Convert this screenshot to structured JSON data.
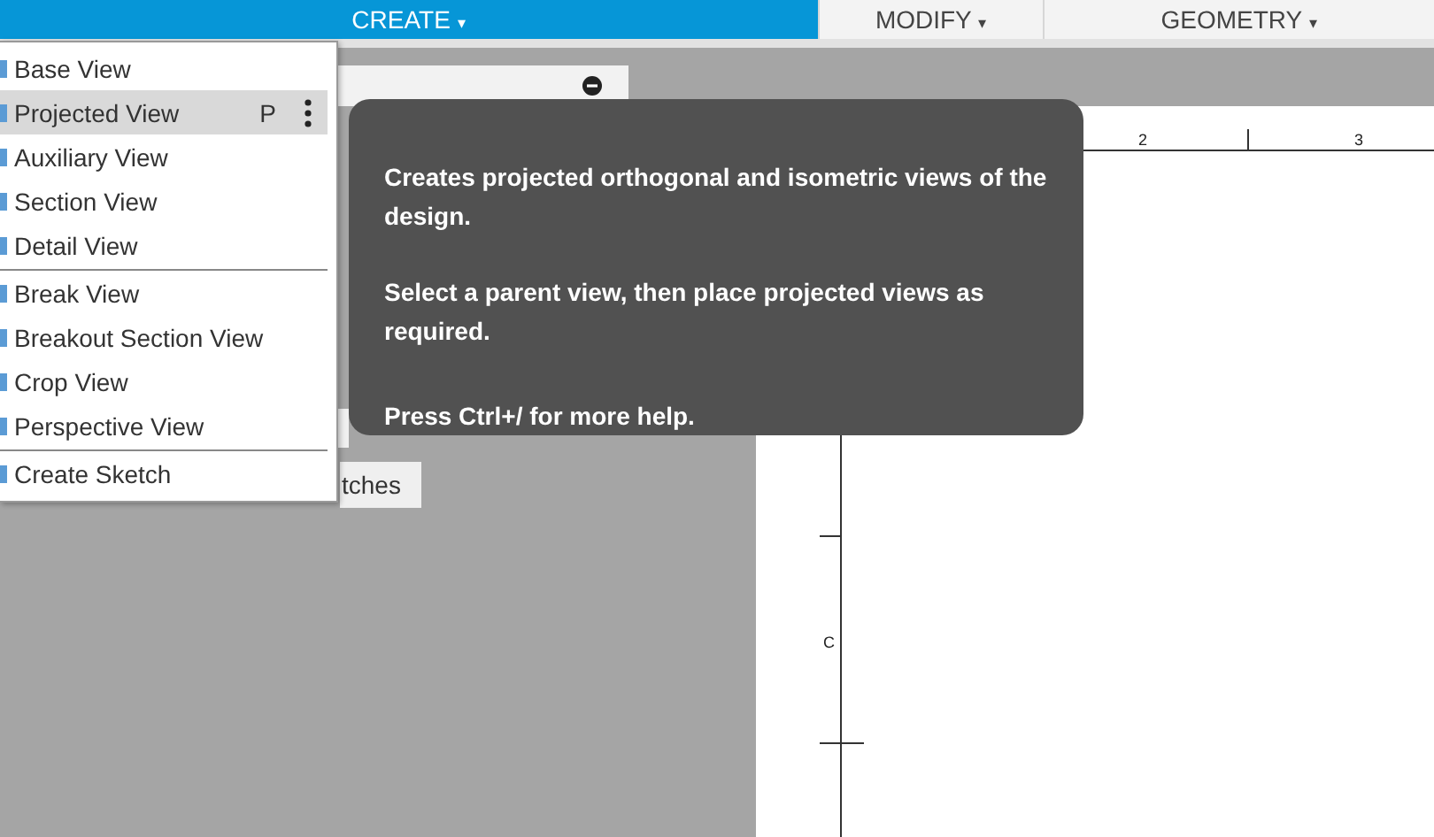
{
  "toolbar": {
    "tabs": [
      {
        "label": "CREATE",
        "caret": "▾",
        "selected": true
      },
      {
        "label": "MODIFY",
        "caret": "▾",
        "selected": false
      },
      {
        "label": "GEOMETRY",
        "caret": "▾",
        "selected": false
      }
    ]
  },
  "panel": {
    "button": "tches"
  },
  "menu": {
    "groups": [
      {
        "items": [
          {
            "label": "Base View",
            "selected": false
          },
          {
            "label": "Projected View",
            "selected": true,
            "shortcut": "P"
          },
          {
            "label": "Auxiliary View",
            "selected": false
          },
          {
            "label": "Section View",
            "selected": false
          },
          {
            "label": "Detail View",
            "selected": false
          }
        ]
      },
      {
        "items": [
          {
            "label": "Break View",
            "selected": false
          },
          {
            "label": "Breakout Section View",
            "selected": false
          },
          {
            "label": "Crop View",
            "selected": false
          },
          {
            "label": "Perspective View",
            "selected": false
          }
        ]
      },
      {
        "items": [
          {
            "label": "Create Sketch",
            "selected": false
          }
        ]
      }
    ]
  },
  "tooltip": {
    "paragraphs": [
      "Creates projected orthogonal and isometric views of the design.",
      "Select a parent view, then place projected views as required.",
      "Press Ctrl+/ for more help."
    ]
  },
  "sheet": {
    "column_labels": [
      "2",
      "3"
    ],
    "row_labels": [
      "C"
    ]
  }
}
